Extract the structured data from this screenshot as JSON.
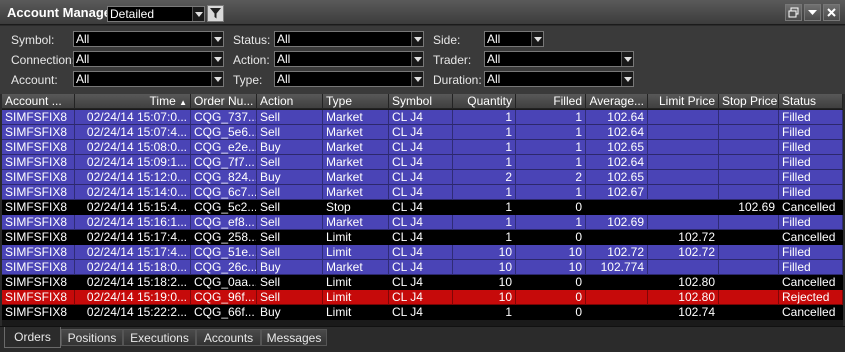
{
  "window": {
    "title": "Account Manager",
    "layout_value": "Detailed",
    "controls": [
      "restore",
      "minimize",
      "close"
    ]
  },
  "filters": {
    "symbol": {
      "label": "Symbol:",
      "value": "All"
    },
    "connection": {
      "label": "Connection:",
      "value": "All"
    },
    "account": {
      "label": "Account:",
      "value": "All"
    },
    "status": {
      "label": "Status:",
      "value": "All"
    },
    "action": {
      "label": "Action:",
      "value": "All"
    },
    "type": {
      "label": "Type:",
      "value": "All"
    },
    "side": {
      "label": "Side:",
      "value": "All"
    },
    "trader": {
      "label": "Trader:",
      "value": "All"
    },
    "duration": {
      "label": "Duration:",
      "value": "All"
    }
  },
  "columns": [
    "Account ...",
    "Time",
    "Order Nu...",
    "Action",
    "Type",
    "Symbol",
    "Quantity",
    "Filled",
    "Average...",
    "Limit Price",
    "Stop Price",
    "Status"
  ],
  "sort": {
    "column": "Time",
    "direction": "ascending"
  },
  "colors": {
    "filled_row": "#4a44b6",
    "filled_row_alt": "#403aa6",
    "cancelled_row": "#000000",
    "rejected_row": "#c60a0a",
    "header_bg": "#4a4a4a"
  },
  "rows": [
    {
      "account": "SIMFSFIX8",
      "time": "02/24/14 15:07:0...",
      "order": "CQG_737...",
      "action": "Sell",
      "type": "Market",
      "symbol": "CL J4",
      "quantity": "1",
      "filled": "1",
      "average": "102.64",
      "limit": "",
      "stop": "",
      "status": "Filled",
      "state": "filled"
    },
    {
      "account": "SIMFSFIX8",
      "time": "02/24/14 15:07:4...",
      "order": "CQG_5e6...",
      "action": "Sell",
      "type": "Market",
      "symbol": "CL J4",
      "quantity": "1",
      "filled": "1",
      "average": "102.64",
      "limit": "",
      "stop": "",
      "status": "Filled",
      "state": "filled"
    },
    {
      "account": "SIMFSFIX8",
      "time": "02/24/14 15:08:0...",
      "order": "CQG_e2e...",
      "action": "Buy",
      "type": "Market",
      "symbol": "CL J4",
      "quantity": "1",
      "filled": "1",
      "average": "102.65",
      "limit": "",
      "stop": "",
      "status": "Filled",
      "state": "filled"
    },
    {
      "account": "SIMFSFIX8",
      "time": "02/24/14 15:09:1...",
      "order": "CQG_7f7...",
      "action": "Sell",
      "type": "Market",
      "symbol": "CL J4",
      "quantity": "1",
      "filled": "1",
      "average": "102.64",
      "limit": "",
      "stop": "",
      "status": "Filled",
      "state": "filled"
    },
    {
      "account": "SIMFSFIX8",
      "time": "02/24/14 15:12:0...",
      "order": "CQG_824...",
      "action": "Buy",
      "type": "Market",
      "symbol": "CL J4",
      "quantity": "2",
      "filled": "2",
      "average": "102.65",
      "limit": "",
      "stop": "",
      "status": "Filled",
      "state": "filled"
    },
    {
      "account": "SIMFSFIX8",
      "time": "02/24/14 15:14:0...",
      "order": "CQG_6c7...",
      "action": "Sell",
      "type": "Market",
      "symbol": "CL J4",
      "quantity": "1",
      "filled": "1",
      "average": "102.67",
      "limit": "",
      "stop": "",
      "status": "Filled",
      "state": "filled"
    },
    {
      "account": "SIMFSFIX8",
      "time": "02/24/14 15:15:4...",
      "order": "CQG_5c2...",
      "action": "Sell",
      "type": "Stop",
      "symbol": "CL J4",
      "quantity": "1",
      "filled": "0",
      "average": "",
      "limit": "",
      "stop": "102.69",
      "status": "Cancelled",
      "state": "cancelled"
    },
    {
      "account": "SIMFSFIX8",
      "time": "02/24/14 15:16:1...",
      "order": "CQG_ef8...",
      "action": "Sell",
      "type": "Market",
      "symbol": "CL J4",
      "quantity": "1",
      "filled": "1",
      "average": "102.69",
      "limit": "",
      "stop": "",
      "status": "Filled",
      "state": "filled"
    },
    {
      "account": "SIMFSFIX8",
      "time": "02/24/14 15:17:4...",
      "order": "CQG_258...",
      "action": "Sell",
      "type": "Limit",
      "symbol": "CL J4",
      "quantity": "1",
      "filled": "0",
      "average": "",
      "limit": "102.72",
      "stop": "",
      "status": "Cancelled",
      "state": "cancelled"
    },
    {
      "account": "SIMFSFIX8",
      "time": "02/24/14 15:17:4...",
      "order": "CQG_51e...",
      "action": "Sell",
      "type": "Limit",
      "symbol": "CL J4",
      "quantity": "10",
      "filled": "10",
      "average": "102.72",
      "limit": "102.72",
      "stop": "",
      "status": "Filled",
      "state": "filled"
    },
    {
      "account": "SIMFSFIX8",
      "time": "02/24/14 15:18:0...",
      "order": "CQG_26c...",
      "action": "Buy",
      "type": "Market",
      "symbol": "CL J4",
      "quantity": "10",
      "filled": "10",
      "average": "102.774",
      "limit": "",
      "stop": "",
      "status": "Filled",
      "state": "filled"
    },
    {
      "account": "SIMFSFIX8",
      "time": "02/24/14 15:18:2...",
      "order": "CQG_0aa...",
      "action": "Sell",
      "type": "Limit",
      "symbol": "CL J4",
      "quantity": "10",
      "filled": "0",
      "average": "",
      "limit": "102.80",
      "stop": "",
      "status": "Cancelled",
      "state": "cancelled"
    },
    {
      "account": "SIMFSFIX8",
      "time": "02/24/14 15:19:0...",
      "order": "CQG_96f...",
      "action": "Sell",
      "type": "Limit",
      "symbol": "CL J4",
      "quantity": "10",
      "filled": "0",
      "average": "",
      "limit": "102.80",
      "stop": "",
      "status": "Rejected",
      "state": "rejected"
    },
    {
      "account": "SIMFSFIX8",
      "time": "02/24/14 15:22:2...",
      "order": "CQG_66f...",
      "action": "Buy",
      "type": "Limit",
      "symbol": "CL J4",
      "quantity": "1",
      "filled": "0",
      "average": "",
      "limit": "102.74",
      "stop": "",
      "status": "Cancelled",
      "state": "cancelled"
    }
  ],
  "tabs": [
    {
      "label": "Orders",
      "active": true
    },
    {
      "label": "Positions",
      "active": false
    },
    {
      "label": "Executions",
      "active": false
    },
    {
      "label": "Accounts",
      "active": false
    },
    {
      "label": "Messages",
      "active": false
    }
  ]
}
